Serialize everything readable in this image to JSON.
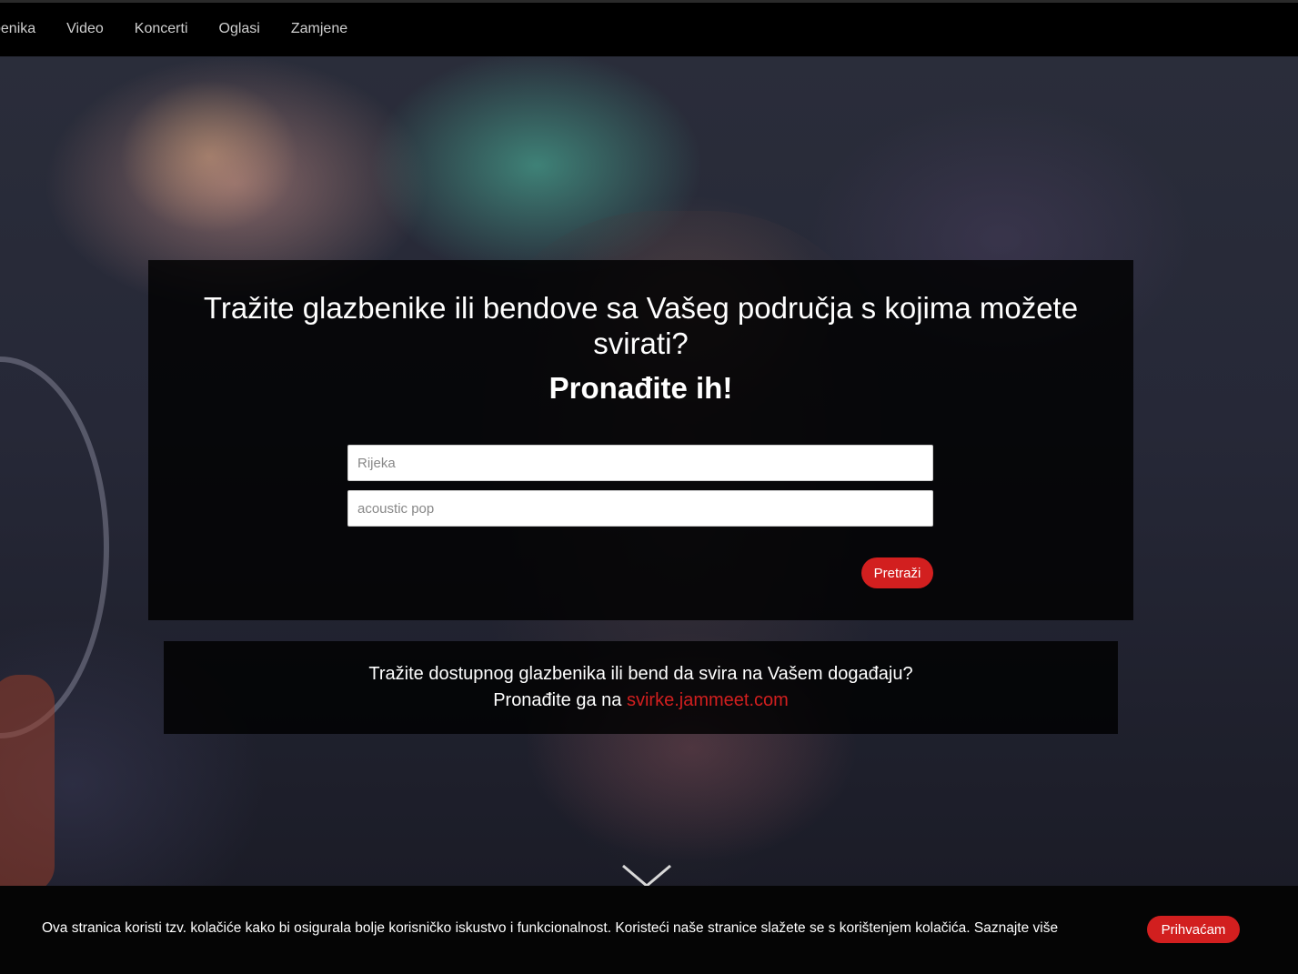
{
  "nav": {
    "items": [
      {
        "label": "zbenika"
      },
      {
        "label": "Video"
      },
      {
        "label": "Koncerti"
      },
      {
        "label": "Oglasi"
      },
      {
        "label": "Zamjene"
      }
    ]
  },
  "search_panel": {
    "headline": "Tražite glazbenike ili bendove sa Vašeg područja s kojima možete svirati?",
    "subheadline": "Pronađite ih!",
    "location_placeholder": "Rijeka",
    "genre_placeholder": "acoustic pop",
    "search_button_label": "Pretraži"
  },
  "promo": {
    "line1": "Tražite dostupnog glazbenika ili bend da svira na Vašem događaju?",
    "line2_prefix": "Pronađite ga na",
    "link_text": "svirke.jammeet.com"
  },
  "cookie_bar": {
    "text": "Ova stranica koristi tzv. kolačiće kako bi osigurala bolje korisničko iskustvo i funkcionalnost. Koristeći naše stranice slažete se s korištenjem kolačića. Saznajte više",
    "accept_label": "Prihvaćam"
  },
  "colors": {
    "accent": "#d21f1f",
    "nav_background": "#000000",
    "panel_background": "rgba(0,0,0,0.82)"
  },
  "icons": {
    "scroll_down": "chevron-down-icon"
  }
}
